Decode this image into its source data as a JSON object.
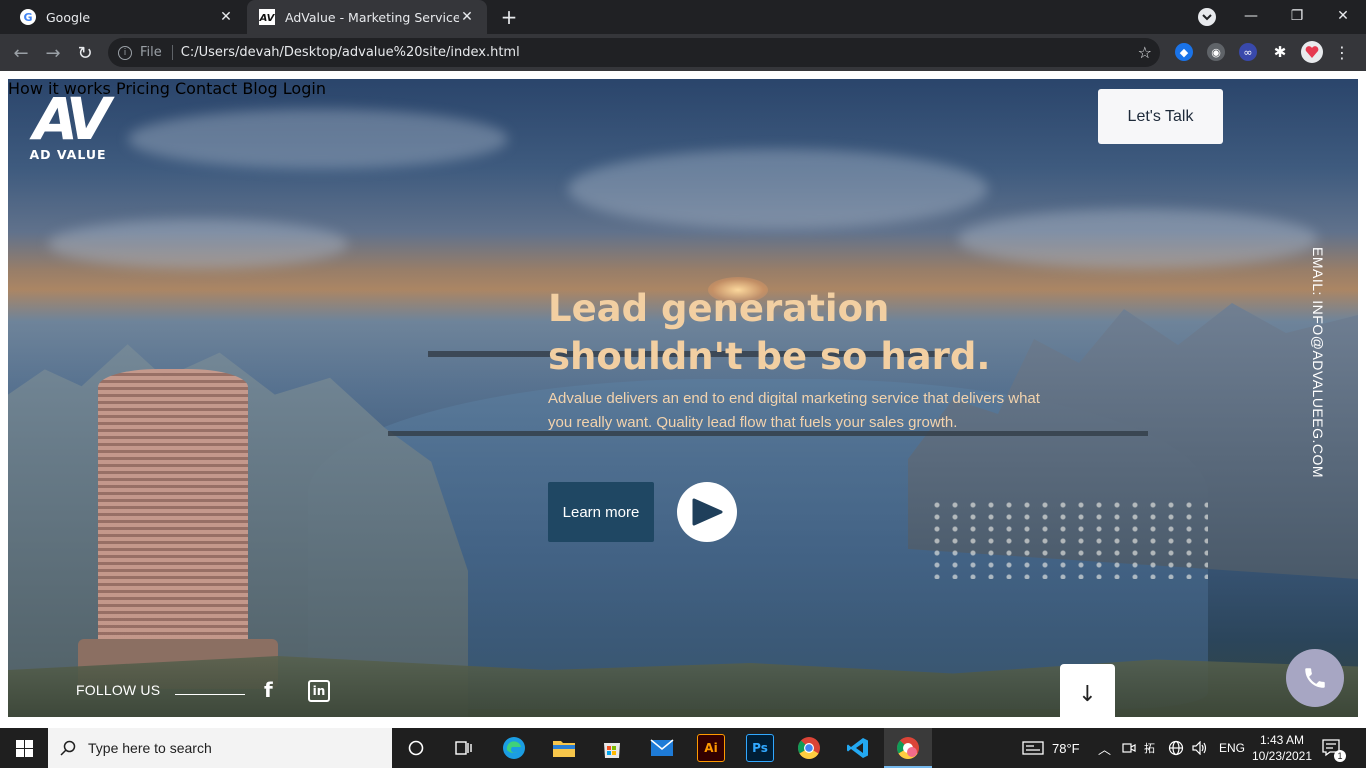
{
  "browser": {
    "tabs": [
      {
        "title": "Google",
        "active": false
      },
      {
        "title": "AdValue - Marketing Service",
        "active": true
      }
    ],
    "scheme_label": "File",
    "url": "C:/Users/devah/Desktop/advalue%20site/index.html"
  },
  "site": {
    "logo": {
      "mark": "AV",
      "wordmark": "AD VALUE"
    },
    "nav": [
      "How it works",
      "Pricing",
      "Contact",
      "Blog",
      "Login"
    ],
    "cta_label": "Let's Talk",
    "hero": {
      "headline_line1": "Lead generation",
      "headline_line2": "shouldn't be so hard.",
      "subtext": "Advalue delivers an end to end digital marketing service that delivers what you really want. Quality lead flow that fuels your sales growth.",
      "learn_more": "Learn more"
    },
    "email_vertical": "EMAIL: INFO@ADVALUEEG.COM",
    "follow_label": "FOLLOW US",
    "scroll_arrow": "↓",
    "colors": {
      "headline": "#f2cfa2",
      "button_dark": "#1f4763",
      "call_button": "#a7a6c3"
    }
  },
  "taskbar": {
    "search_placeholder": "Type here to search",
    "weather": "78°F",
    "language": "ENG",
    "time": "1:43 AM",
    "date": "10/23/2021",
    "notification_count": "1",
    "apps": [
      "task-view",
      "edge",
      "file-explorer",
      "store",
      "mail",
      "illustrator",
      "photoshop",
      "chrome",
      "vscode",
      "chrome-profile"
    ]
  }
}
